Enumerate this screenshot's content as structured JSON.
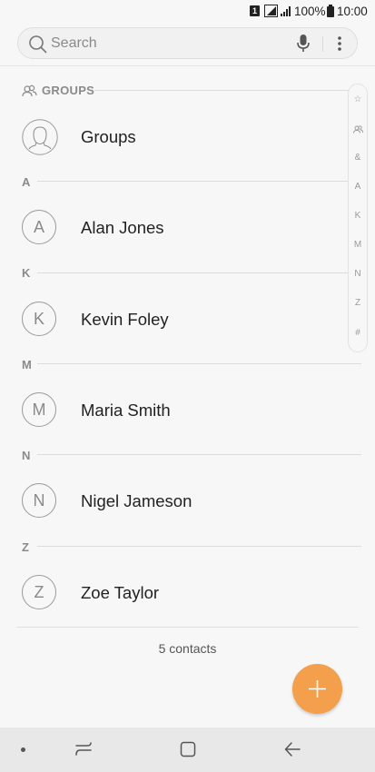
{
  "status_bar": {
    "sim": "1",
    "battery": "100%",
    "time": "10:00"
  },
  "search": {
    "placeholder": "Search"
  },
  "groups_section": {
    "label": "GROUPS",
    "item": "Groups"
  },
  "contacts": [
    {
      "section": "A",
      "initial": "A",
      "name": "Alan Jones"
    },
    {
      "section": "K",
      "initial": "K",
      "name": "Kevin Foley"
    },
    {
      "section": "M",
      "initial": "M",
      "name": "Maria Smith"
    },
    {
      "section": "N",
      "initial": "N",
      "name": "Nigel Jameson"
    },
    {
      "section": "Z",
      "initial": "Z",
      "name": "Zoe Taylor"
    }
  ],
  "footer": {
    "count": "5 contacts"
  },
  "index": [
    "☆",
    "groups-icon",
    "&",
    "A",
    "K",
    "M",
    "N",
    "Z",
    "#"
  ],
  "colors": {
    "fab": "#f39f4b",
    "background": "#f7f7f7",
    "nav_bar": "#e8e8e8"
  }
}
